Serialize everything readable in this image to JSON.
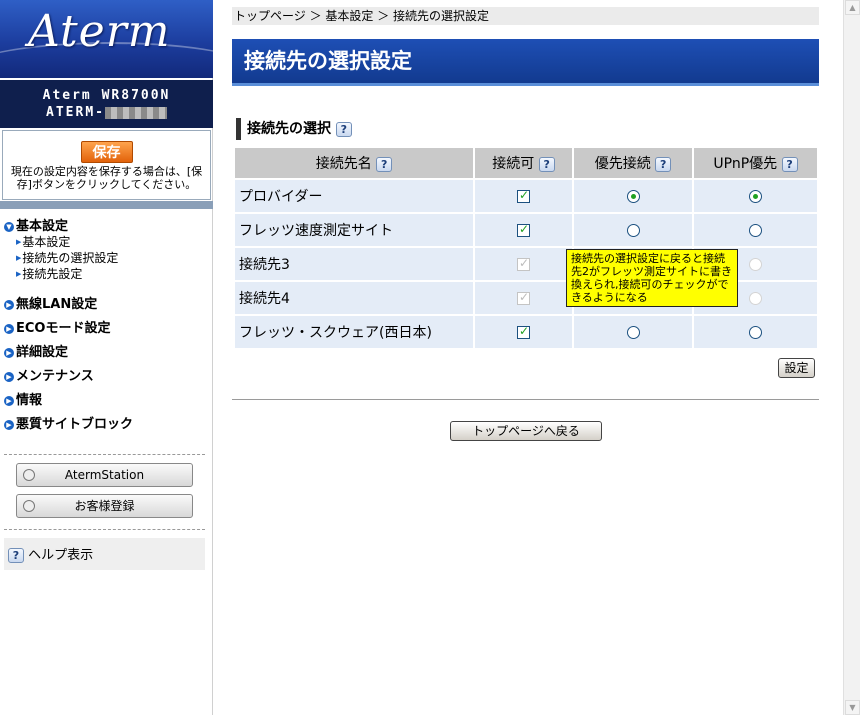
{
  "sidebar": {
    "logo_text": "Aterm",
    "model_line1": "Aterm WR8700N",
    "model_line2_prefix": "ATERM-",
    "save_label": "保存",
    "save_desc": "現在の設定内容を保存する場合は、[保存]ボタンをクリックしてください。",
    "nav": [
      {
        "label": "基本設定",
        "subs": [
          "基本設定",
          "接続先の選択設定",
          "接続先設定"
        ]
      },
      {
        "label": "無線LAN設定"
      },
      {
        "label": "ECOモード設定"
      },
      {
        "label": "詳細設定"
      },
      {
        "label": "メンテナンス"
      },
      {
        "label": "情報"
      },
      {
        "label": "悪質サイトブロック"
      }
    ],
    "aterm_station_label": "AtermStation",
    "register_label": "お客様登録",
    "help_label": "ヘルプ表示"
  },
  "main": {
    "breadcrumb": "トップページ ＞ 基本設定 ＞ 接続先の選択設定",
    "page_title": "接続先の選択設定",
    "section_title": "接続先の選択",
    "table": {
      "headers": [
        "接続先名",
        "接続可",
        "優先接続",
        "UPnP優先"
      ],
      "rows": [
        {
          "name": "プロバイダー",
          "enabled": "checked",
          "priority": "selected",
          "upnp": "selected"
        },
        {
          "name": "フレッツ速度測定サイト",
          "enabled": "checked",
          "priority": "unselected",
          "upnp": "unselected"
        },
        {
          "name": "接続先3",
          "enabled": "disabled",
          "priority": "disabled",
          "upnp": "disabled"
        },
        {
          "name": "接続先4",
          "enabled": "disabled",
          "priority": "disabled",
          "upnp": "disabled"
        },
        {
          "name": "フレッツ・スクウェア(西日本)",
          "enabled": "checked",
          "priority": "unselected",
          "upnp": "unselected"
        }
      ]
    },
    "tooltip_text": "接続先の選択設定に戻ると接続先2がフレッツ測定サイトに書き換えられ,接続可のチェックができるようになる",
    "set_button": "設定",
    "top_button": "トップページへ戻る"
  },
  "help_icon": "?",
  "colors": {
    "title_bar": "#1a46a8",
    "table_header": "#c9c9c9",
    "table_cell": "#e4ecf7",
    "tooltip": "#ffff00",
    "save_button": "#f07a1e"
  }
}
